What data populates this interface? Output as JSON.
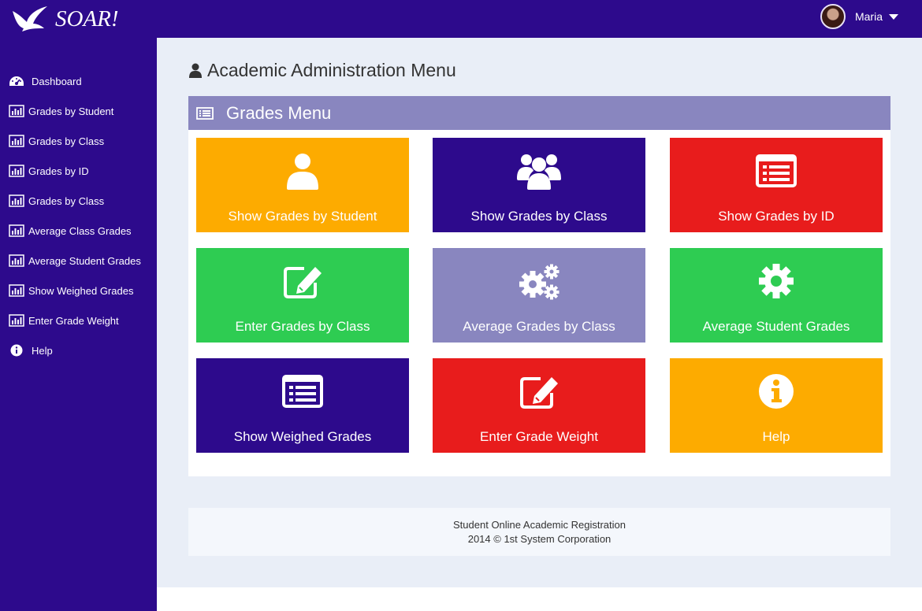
{
  "header": {
    "logo_text": "SOAR!",
    "user_name": "Maria"
  },
  "sidebar": {
    "items": [
      {
        "label": "Dashboard",
        "icon": "dashboard-icon"
      },
      {
        "label": "Grades by Student",
        "icon": "bar-chart-icon"
      },
      {
        "label": "Grades by Class",
        "icon": "bar-chart-icon"
      },
      {
        "label": "Grades by ID",
        "icon": "bar-chart-icon"
      },
      {
        "label": "Grades by Class",
        "icon": "bar-chart-icon"
      },
      {
        "label": "Average Class Grades",
        "icon": "bar-chart-icon"
      },
      {
        "label": "Average Student Grades",
        "icon": "bar-chart-icon"
      },
      {
        "label": "Show Weighed Grades",
        "icon": "bar-chart-icon"
      },
      {
        "label": "Enter Grade Weight",
        "icon": "bar-chart-icon"
      },
      {
        "label": "Help",
        "icon": "info-icon"
      }
    ]
  },
  "main": {
    "title": "Academic Administration Menu",
    "panel_title": "Grades Menu",
    "tiles": [
      {
        "label": "Show Grades by Student",
        "icon": "user-icon",
        "color": "#fdab00"
      },
      {
        "label": "Show Grades by Class",
        "icon": "users-icon",
        "color": "#2d0a8c"
      },
      {
        "label": "Show Grades by ID",
        "icon": "list-icon",
        "color": "#e81c1c"
      },
      {
        "label": "Enter Grades by Class",
        "icon": "edit-icon",
        "color": "#2ecc52"
      },
      {
        "label": "Average Grades by Class",
        "icon": "gears-icon",
        "color": "#8986bf"
      },
      {
        "label": "Average Student Grades",
        "icon": "gear-icon",
        "color": "#2ecc52"
      },
      {
        "label": "Show Weighed Grades",
        "icon": "list-icon",
        "color": "#2d0a8c"
      },
      {
        "label": "Enter Grade Weight",
        "icon": "edit-icon",
        "color": "#e81c1c"
      },
      {
        "label": "Help",
        "icon": "info-icon",
        "color": "#fdab00"
      }
    ]
  },
  "footer": {
    "line1": "Student Online Academic Registration",
    "line2": "2014 © 1st System Corporation"
  },
  "colors": {
    "brand": "#2d0a8c",
    "panel_header": "#8986bf",
    "page_bg": "#e9eef7"
  }
}
